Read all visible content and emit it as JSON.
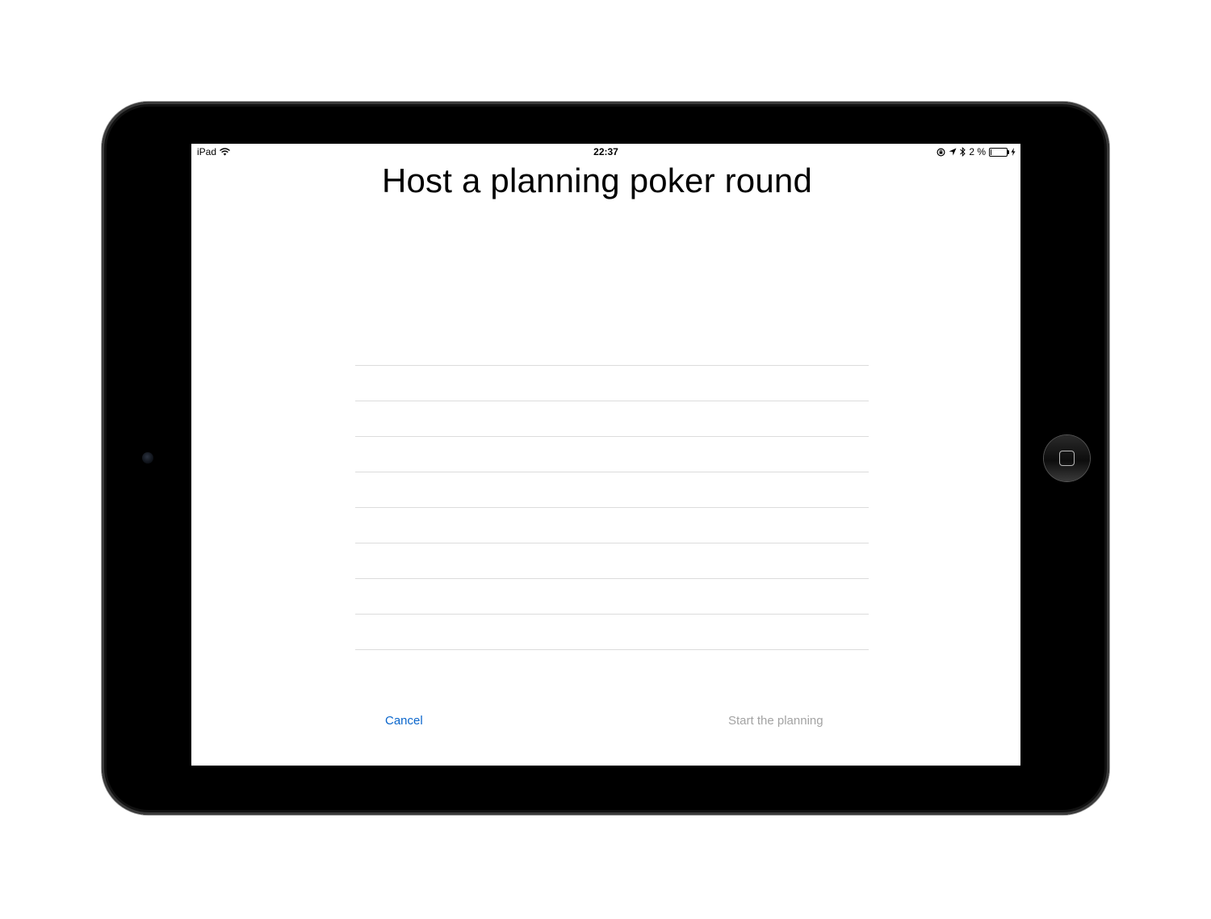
{
  "status_bar": {
    "device": "iPad",
    "time": "22:37",
    "battery_text": "2 %",
    "battery_level_percent": 2,
    "icons": [
      "wifi-icon",
      "rotation-lock-icon",
      "location-arrow-icon",
      "bluetooth-icon",
      "battery-icon",
      "charging-bolt-icon"
    ]
  },
  "main": {
    "title": "Host a planning poker round",
    "participants": [
      "",
      "",
      "",
      "",
      "",
      "",
      "",
      ""
    ]
  },
  "footer": {
    "cancel_label": "Cancel",
    "start_label": "Start the planning"
  },
  "colors": {
    "link_blue": "#0a66cc",
    "disabled_gray": "#a3a3a3",
    "separator": "#dcdcdc"
  }
}
